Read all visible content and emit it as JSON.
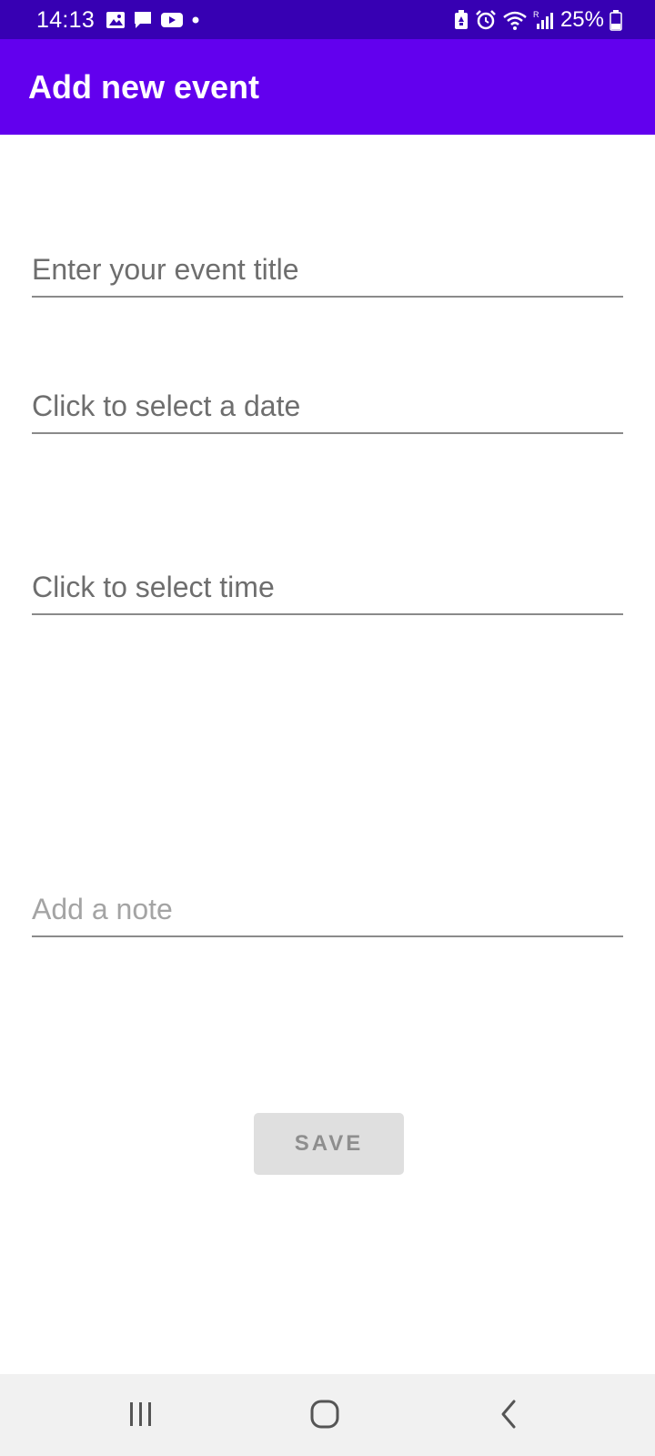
{
  "status_bar": {
    "time": "14:13",
    "notification_icons": [
      "gallery-icon",
      "message-icon",
      "youtube-icon",
      "dot-icon"
    ],
    "system_icons": [
      "battery-saver-icon",
      "alarm-icon",
      "wifi-icon",
      "signal-icon"
    ],
    "battery_percent": "25%",
    "background_color": "#3700b3"
  },
  "app_bar": {
    "title": "Add new event",
    "background_color": "#6200ee"
  },
  "form": {
    "title_field": "Enter your event title",
    "date_field": "Click to select a date",
    "time_field": "Click to select time",
    "note_placeholder": "Add a note",
    "save_label": "SAVE"
  },
  "nav_bar": {
    "buttons": [
      "recents-icon",
      "home-icon",
      "back-icon"
    ]
  }
}
